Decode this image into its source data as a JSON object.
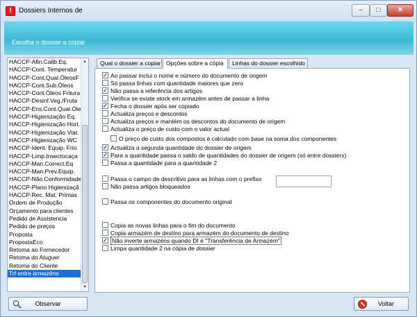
{
  "window": {
    "title": "Dossiers Internos de",
    "buttons": {
      "minimize": "–",
      "maximize": "□",
      "close": "✕"
    }
  },
  "header": {
    "subtitle": "Escolha o dossier a copiar"
  },
  "dossier_list": {
    "items": [
      "HACCP-Afin.Calib.Eq.",
      "HACCP-Cont. Temperatur",
      "HACCP-Cont.Qual.ÓleosF",
      "HACCP-Cont.Sub.Óleos",
      "HACCP-Cont.Óleos Fritura",
      "HACCP-Desinf.Veg./Fruta",
      "HACCP-Ens.Cont.Qual.Óle",
      "HACCP-Higienização Eq.",
      "HACCP-Higienização Hort.",
      "HACCP-Higienização Viat.",
      "HACCP-Higienização WC",
      "HACCP-Ident. Equip. Frio",
      "HACCP-Limp.Insectocaça",
      "HACCP-Man.Correct.Eq",
      "HACCP-Man.Prev.Equip.",
      "HACCP-Não Conformidade",
      "HACCP-Plano Higienizaçã",
      "HACCP-Rec. Mat. Primas",
      "Ordem de Produção",
      "Orçamento para clientes",
      "Pedido de Assistencia",
      "Pedido de preços",
      "Proposta",
      "PropostaEco",
      "Retoma ao Fornecedor",
      "Retoma do Aluguer",
      "Retoma do Cliente",
      "Trf entre armazéns"
    ],
    "selected": "Trf entre armazéns"
  },
  "tabs": [
    {
      "label": "Qual o dossier a copiar",
      "active": false
    },
    {
      "label": "Opções sobre a cópia",
      "active": true
    },
    {
      "label": "Linhas do dossier escolhido",
      "active": false
    }
  ],
  "options": [
    {
      "label": "Ao passar inclui o nome e número do documento de origem",
      "checked": true
    },
    {
      "label": "Só passa linhas com quantidade maiores que zero",
      "checked": false
    },
    {
      "label": "Não passa a referência dos artigos",
      "checked": true
    },
    {
      "label": "Verifica se existe stock em armazém antes de passar a linha",
      "checked": false
    },
    {
      "label": "Fecha o dossier após ser copiado",
      "checked": true
    },
    {
      "label": "Actualiza preços e descontos",
      "checked": false
    },
    {
      "label": "Actualiza preços e mantém os descontos do documento de origem",
      "checked": false
    },
    {
      "label": "Actualiza o preço de custo com o valor actual",
      "checked": false
    },
    {
      "label": "O preço de custo dos compostos é calculado com base na soma dos componentes",
      "checked": false
    },
    {
      "label": "Actualiza a segunda quantidade do dossier de origem",
      "checked": true
    },
    {
      "label": "Para a quantidade passa o saldo de quantidades do dossier de origem (só entre dossiers)",
      "checked": true
    },
    {
      "label": "Passa a quantidade para a quantidade 2",
      "checked": false
    },
    {
      "label": "Passa o campo de descritivo para as linhas com o prefixo",
      "checked": false
    },
    {
      "label": "Não passa artigos bloqueados",
      "checked": false
    },
    {
      "label": "Passa os componentes do documento original",
      "checked": false
    },
    {
      "label": "Copia as novas linhas para o fim do documento",
      "checked": false
    },
    {
      "label": "Copia armazém de destino para armazém do documento de destino",
      "checked": false
    },
    {
      "label": "Não inverte armazéns quando DI é \"Transferência de Armazém\"",
      "checked": true
    },
    {
      "label": "Limpa quantidade 2 na cópia de dossier",
      "checked": false
    }
  ],
  "prefix_input": {
    "value": ""
  },
  "footer": {
    "observar_label": "Observar",
    "voltar_label": "Voltar"
  },
  "icons": {
    "observar": "magnifier-icon",
    "voltar": "cancel-icon"
  },
  "colors": {
    "header_band": "#3bb8d6",
    "selection": "#1e6fd0",
    "close_button": "#c8412a"
  }
}
